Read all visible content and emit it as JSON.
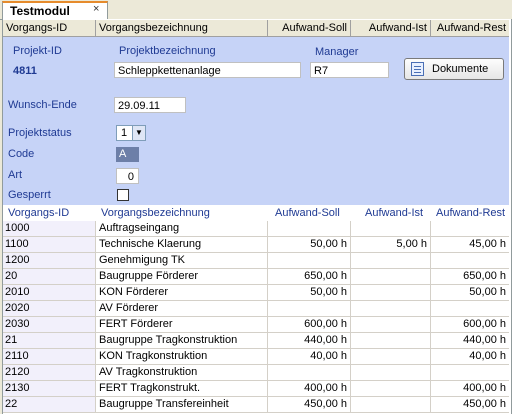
{
  "tab": {
    "title": "Testmodul",
    "close": "×"
  },
  "columns": [
    "Vorgangs-ID",
    "Vorgangsbezeichnung",
    "Aufwand-Soll",
    "Aufwand-Ist",
    "Aufwand-Rest"
  ],
  "detail": {
    "projekt_id_label": "Projekt-ID",
    "projekt_id": "4811",
    "projektbezeichnung_label": "Projektbezeichnung",
    "projektbezeichnung": "Schleppkettenanlage",
    "manager_label": "Manager",
    "manager": "R7",
    "dokumente_button": "Dokumente",
    "wunsch_ende_label": "Wunsch-Ende",
    "wunsch_ende": "29.09.11",
    "projektstatus_label": "Projektstatus",
    "projektstatus": "1",
    "code_label": "Code",
    "code": "A",
    "art_label": "Art",
    "art": "0",
    "gesperrt_label": "Gesperrt",
    "gesperrt": false
  },
  "table": {
    "headers": [
      "Vorgangs-ID",
      "Vorgangsbezeichnung",
      "Aufwand-Soll",
      "Aufwand-Ist",
      "Aufwand-Rest"
    ],
    "rows": [
      [
        "1000",
        "Auftragseingang",
        "",
        "",
        ""
      ],
      [
        "1100",
        "Technische Klaerung",
        "50,00 h",
        "5,00 h",
        "45,00 h"
      ],
      [
        "1200",
        "Genehmigung TK",
        "",
        "",
        ""
      ],
      [
        "20",
        "Baugruppe Förderer",
        "650,00 h",
        "",
        "650,00 h"
      ],
      [
        "2010",
        "KON Förderer",
        "50,00 h",
        "",
        "50,00 h"
      ],
      [
        "2020",
        "AV Förderer",
        "",
        "",
        ""
      ],
      [
        "2030",
        "FERT Förderer",
        "600,00 h",
        "",
        "600,00 h"
      ],
      [
        "21",
        "Baugruppe Tragkonstruktion",
        "440,00 h",
        "",
        "440,00 h"
      ],
      [
        "2110",
        "KON Tragkonstruktion",
        "40,00 h",
        "",
        "40,00 h"
      ],
      [
        "2120",
        "AV Tragkonstruktion",
        "",
        "",
        ""
      ],
      [
        "2130",
        "FERT Tragkonstrukt.",
        "400,00 h",
        "",
        "400,00 h"
      ],
      [
        "22",
        "Baugruppe Transfereinheit",
        "450,00 h",
        "",
        "450,00 h"
      ]
    ]
  },
  "colors": {
    "panel": "#c6d3f7",
    "label": "#1f3a93",
    "tab_accent": "#e68b2c",
    "code_bg": "#6d7fa8"
  }
}
